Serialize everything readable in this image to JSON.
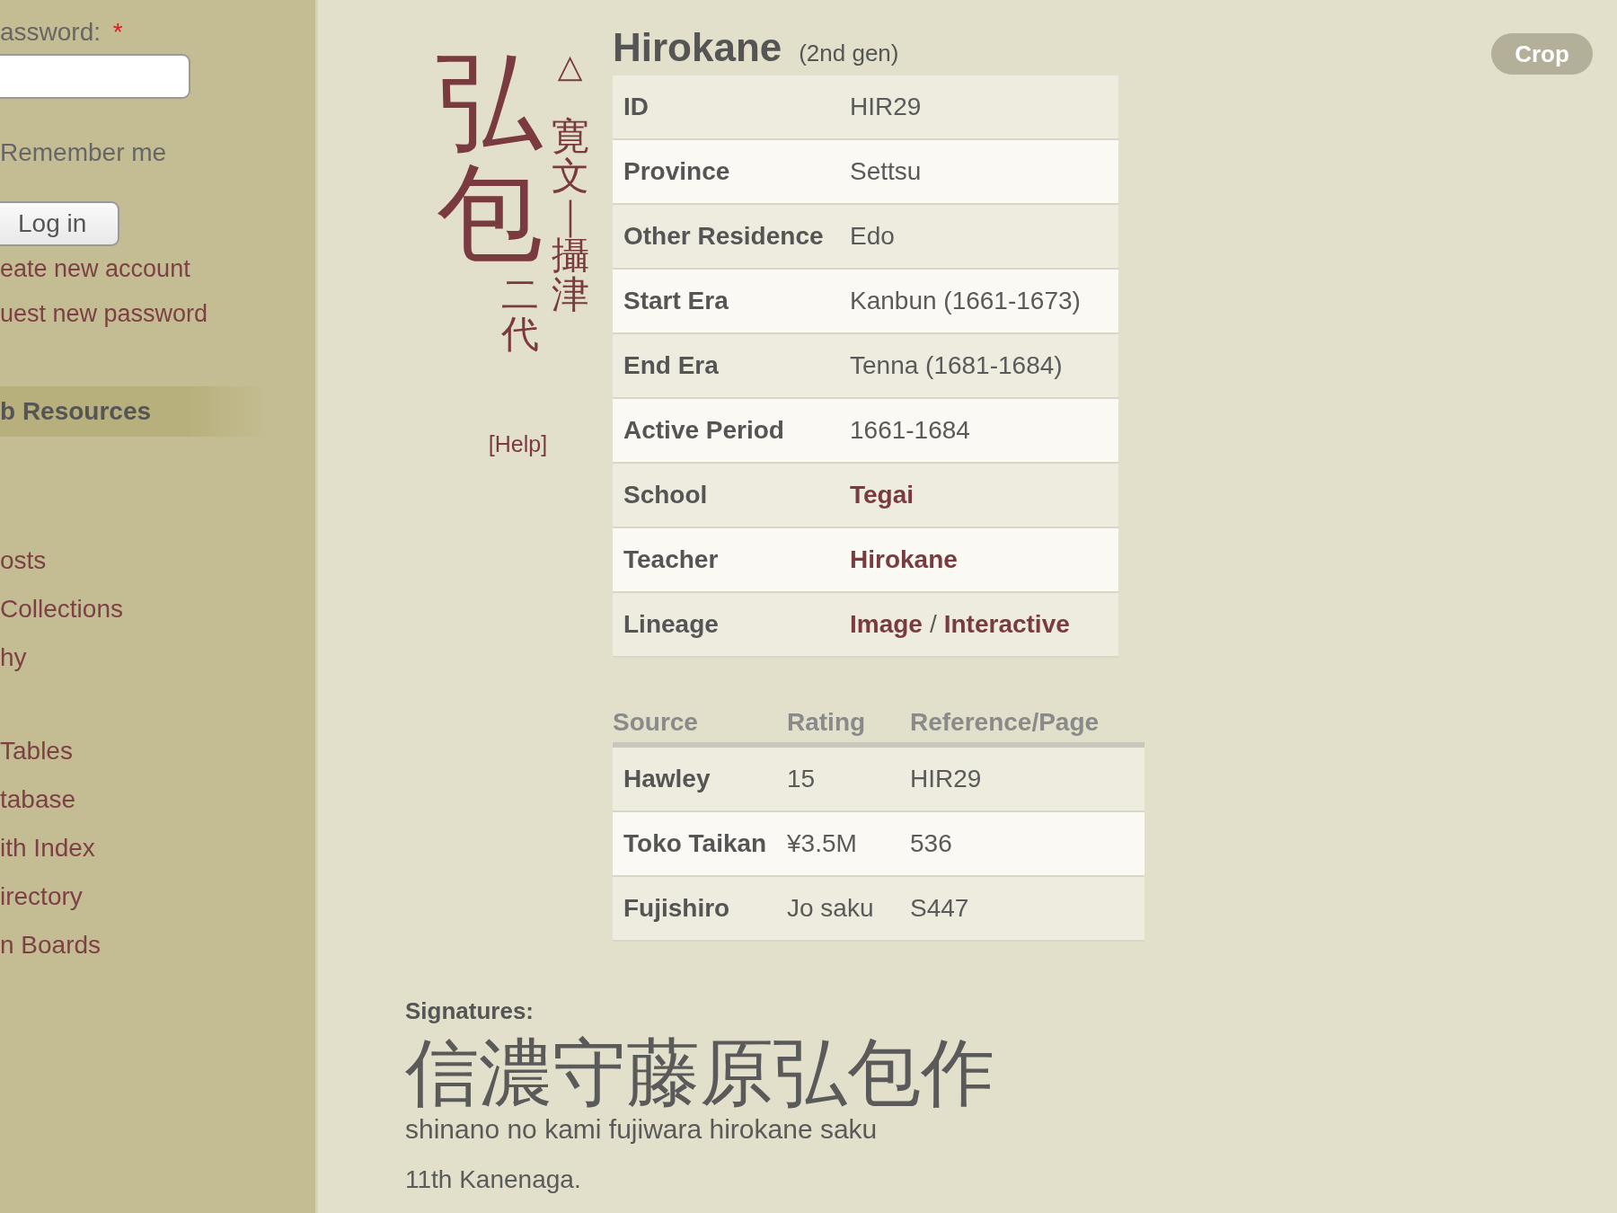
{
  "sidebar": {
    "login": {
      "password_label": "assword:",
      "required_mark": "*",
      "remember_label": "Remember me",
      "login_button": "Log in",
      "links": [
        "eate new account",
        "uest new password"
      ]
    },
    "heading": "b Resources",
    "groups": [
      [
        "osts",
        "Collections",
        "hy"
      ],
      [
        "Tables",
        "tabase",
        "ith Index",
        "irectory",
        "n Boards"
      ]
    ]
  },
  "crop_button": "Crop",
  "kanji": {
    "name_chars": "弘包",
    "generation": "二代",
    "mark": "△",
    "era_province": "寛文｜攝津",
    "help": "[Help]"
  },
  "title": {
    "name": "Hirokane",
    "note": "(2nd gen)"
  },
  "info_rows": [
    {
      "label": "ID",
      "values": [
        {
          "text": "HIR29",
          "kind": "text"
        }
      ]
    },
    {
      "label": "Province",
      "values": [
        {
          "text": "Settsu",
          "kind": "text"
        }
      ]
    },
    {
      "label": "Other Residence",
      "values": [
        {
          "text": "Edo",
          "kind": "text"
        }
      ]
    },
    {
      "label": "Start Era",
      "values": [
        {
          "text": "Kanbun (1661-1673)",
          "kind": "text"
        }
      ]
    },
    {
      "label": "End Era",
      "values": [
        {
          "text": "Tenna (1681-1684)",
          "kind": "text"
        }
      ]
    },
    {
      "label": "Active Period",
      "values": [
        {
          "text": "1661-1684",
          "kind": "text"
        }
      ]
    },
    {
      "label": "School",
      "values": [
        {
          "text": "Tegai",
          "kind": "link"
        }
      ]
    },
    {
      "label": "Teacher",
      "values": [
        {
          "text": "Hirokane",
          "kind": "link"
        }
      ]
    },
    {
      "label": "Lineage",
      "values": [
        {
          "text": "Image",
          "kind": "link"
        },
        {
          "text": "/",
          "kind": "text"
        },
        {
          "text": "Interactive",
          "kind": "link"
        }
      ]
    }
  ],
  "sources": {
    "columns": [
      "Source",
      "Rating",
      "Reference/Page"
    ],
    "rows": [
      [
        "Hawley",
        "15",
        "HIR29"
      ],
      [
        "Toko Taikan",
        "¥3.5M",
        "536"
      ],
      [
        "Fujishiro",
        "Jo saku",
        "S447"
      ]
    ]
  },
  "signatures": {
    "heading": "Signatures:",
    "kanji": "信濃守藤原弘包作",
    "romaji": "shinano no kami fujiwara hirokane saku",
    "note": "11th Kanenaga."
  }
}
